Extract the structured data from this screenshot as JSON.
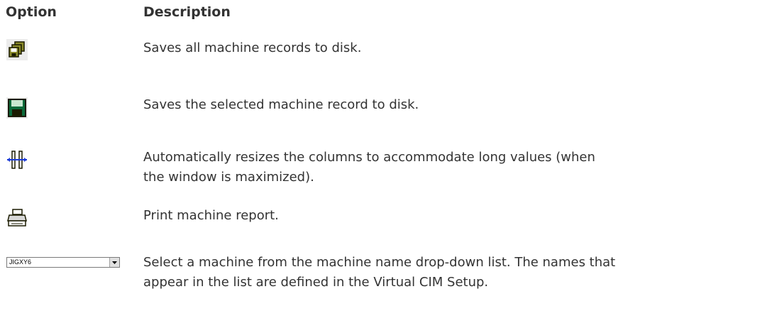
{
  "header": {
    "option_label": "Option",
    "description_label": "Description"
  },
  "rows": [
    {
      "icon": "save-all-icon",
      "description": "Saves all machine records to disk."
    },
    {
      "icon": "save-icon",
      "description": "Saves the selected machine record to disk."
    },
    {
      "icon": "resize-columns-icon",
      "description": "Automatically resizes the columns to accommodate long values (when the window is maximized)."
    },
    {
      "icon": "print-icon",
      "description": "Print machine report."
    },
    {
      "icon": "machine-dropdown",
      "dropdown_value": "JIGXY6",
      "description": "Select a machine from the machine name drop-down list. The names that appear in the list are defined in the Virtual CIM Setup."
    }
  ],
  "colors": {
    "text": "#333333",
    "icon_dark": "#1a1a00",
    "icon_olive": "#8a8a2a",
    "icon_green": "#0a6a3a",
    "icon_blue": "#1a3ad8"
  }
}
